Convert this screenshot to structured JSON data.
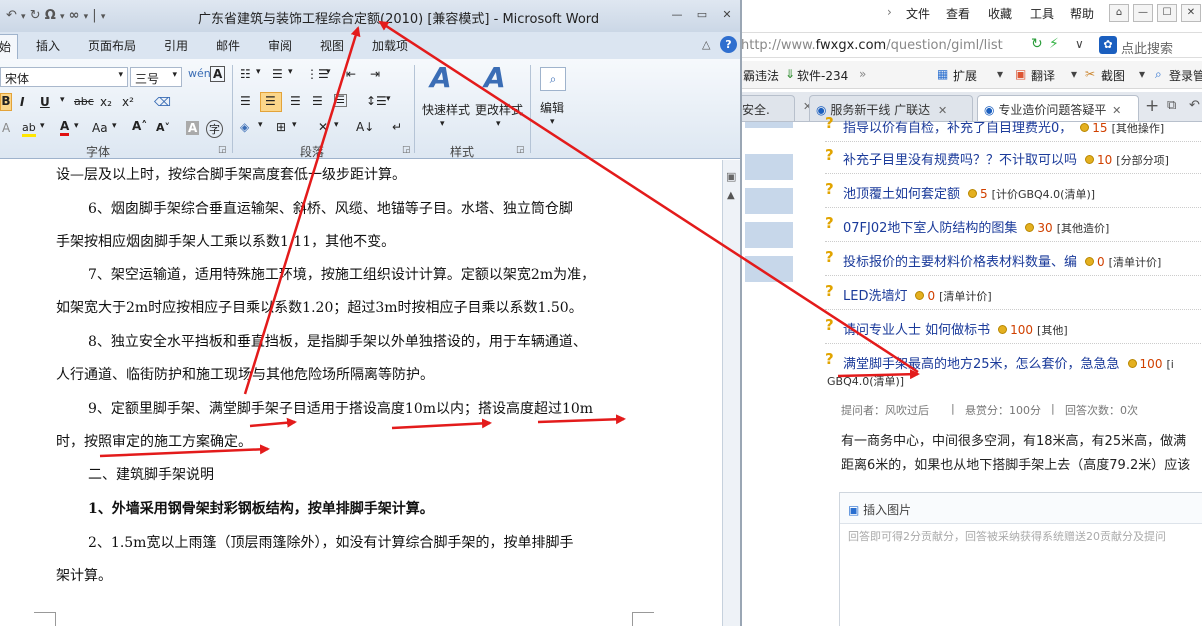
{
  "browser": {
    "menu": [
      "文件",
      "查看",
      "收藏",
      "工具",
      "帮助"
    ],
    "address_url_prefix": "http://www.",
    "address_url_domain": "fwxgx.com",
    "address_url_path": "/question/giml/list",
    "search_placeholder": "点此搜索",
    "bookmarks": [
      "霸违法",
      "软件-234",
      "扩展",
      "翻译",
      "截图",
      "登录管"
    ],
    "tabs": [
      "安全.",
      "服务新干线 广联达",
      "专业造价问题答疑平"
    ],
    "questions": [
      {
        "title": "指导以价有自检，补充了自目理费光0，",
        "num": "15",
        "cat": "[其他操作]"
      },
      {
        "title": "补充子目里没有规费吗？？不计取可以吗",
        "num": "10",
        "cat": "[分部分项]"
      },
      {
        "title": "池顶覆土如何套定额",
        "num": "5",
        "cat": "[计价GBQ4.0(清单)]"
      },
      {
        "title": "07FJ02地下室人防结构的图集",
        "num": "30",
        "cat": "[其他造价]"
      },
      {
        "title": "投标报价的主要材料价格表材料数量、编",
        "num": "0",
        "cat": "[清单计价]"
      },
      {
        "title": "LED洗墙灯",
        "num": "0",
        "cat": "[清单计价]"
      },
      {
        "title": "请问专业人士 如何做标书",
        "num": "100",
        "cat": "[其他]"
      },
      {
        "title": "满堂脚手架最高的地方25米，怎么套价，急急急",
        "num": "100",
        "cat": "[i"
      }
    ],
    "question_wrap": "GBQ4.0(清单)]",
    "info": {
      "asker": "提问者：风吹过后",
      "reward": "悬赏分：100分",
      "answers": "回答次数：0次"
    },
    "answer_lines": [
      "有一商务中心，中间很多空洞，有18米高，有25米高，做满",
      "距离6米的，如果也从地下搭脚手架上去（高度79.2米）应该"
    ],
    "insert_image": "插入图片",
    "answer_placeholder": "回答即可得2分贡献分，回答被采纳获得系统赠送20贡献分及提问"
  },
  "word": {
    "title": "广东省建筑与装饰工程综合定额(2010) [兼容模式] - Microsoft Word",
    "tabs": [
      "开始",
      "插入",
      "页面布局",
      "引用",
      "邮件",
      "审阅",
      "视图",
      "加载项"
    ],
    "font_name": "宋体",
    "font_size": "三号",
    "groups": {
      "font": "字体",
      "paragraph": "段落",
      "style": "样式",
      "edit": "编辑"
    },
    "quick_style": "快速样式",
    "change_style": "更改样式",
    "edit_label": "编辑",
    "paragraphs": [
      "设—层及以上时，按综合脚手架高度套低一级步距计算。",
      "6、烟囱脚手架综合垂直运输架、斜桥、风缆、地锚等子目。水塔、独立筒仓脚",
      "手架按相应烟囱脚手架人工乘以系数1.11，其他不变。",
      "7、架空运输道，适用特殊施工环境，按施工组织设计计算。定额以架宽2m为准，",
      "如架宽大于2m时应按相应子目乘以系数1.20；超过3m时按相应子目乘以系数1.50。",
      "8、独立安全水平挡板和垂直挡板，是指脚手架以外单独搭设的，用于车辆通道、",
      "人行通道、临街防护和施工现场与其他危险场所隔离等防护。",
      "9、定额里脚手架、满堂脚手架子目适用于搭设高度10m以内；搭设高度超过10m",
      "时，按照审定的施工方案确定。",
      "二、建筑脚手架说明",
      "1、外墙采用钢骨架封彩钢板结构，按单排脚手架计算。",
      "2、1.5m宽以上雨篷（顶层雨篷除外），如没有计算综合脚手架的，按单排脚手",
      "架计算。"
    ]
  },
  "colors": {
    "arrow": "#e31b1b",
    "word_title_bg": "#cbd7e6",
    "link": "#1a3a9a"
  }
}
